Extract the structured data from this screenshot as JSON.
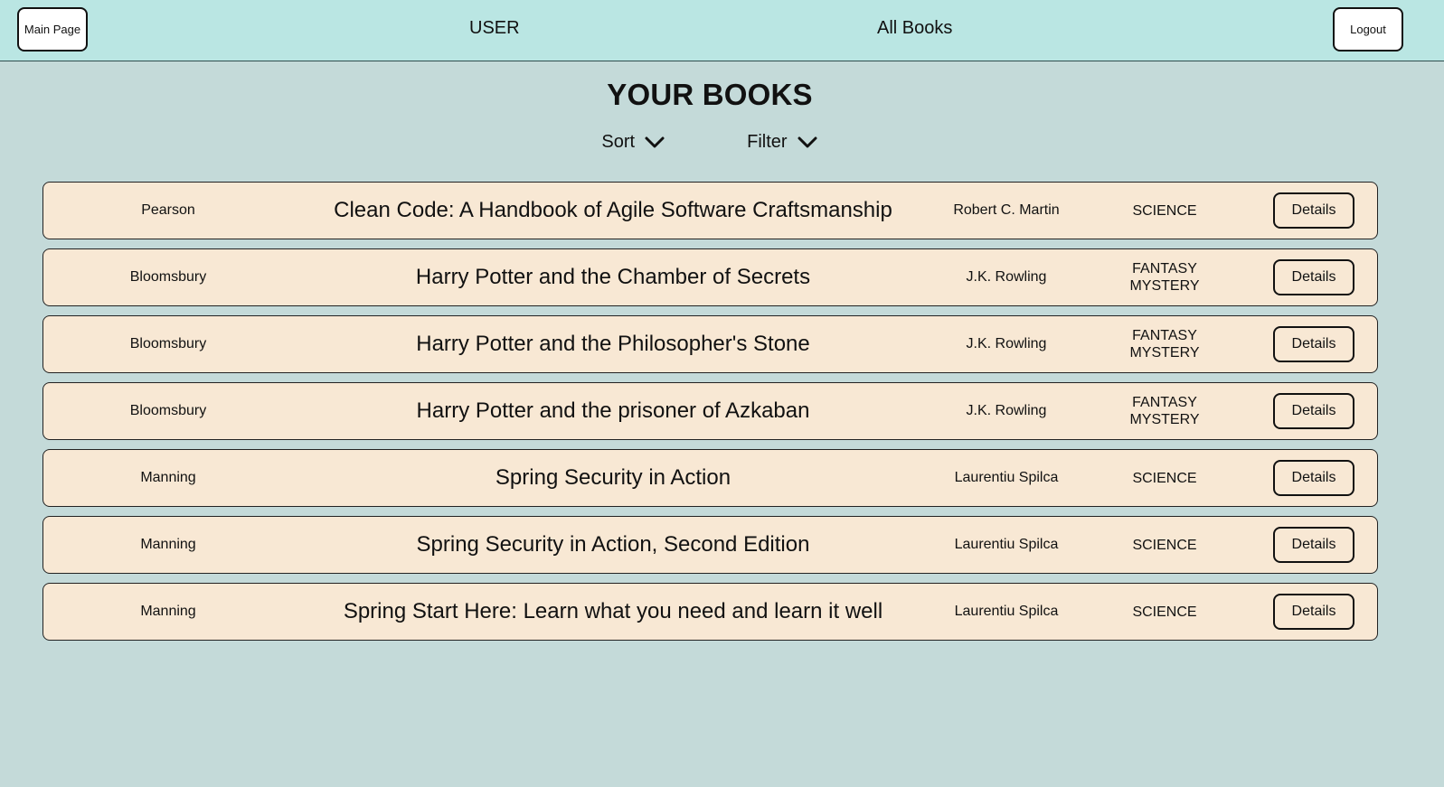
{
  "header": {
    "main_page_label": "Main Page",
    "user_label": "USER",
    "all_books_label": "All Books",
    "logout_label": "Logout"
  },
  "page": {
    "title": "YOUR BOOKS",
    "sort_label": "Sort",
    "filter_label": "Filter"
  },
  "books": [
    {
      "publisher": "Pearson",
      "title": "Clean Code: A Handbook of Agile Software Craftsmanship",
      "author": "Robert C. Martin",
      "genres": [
        "SCIENCE"
      ],
      "details_label": "Details"
    },
    {
      "publisher": "Bloomsbury",
      "title": "Harry Potter and the Chamber of Secrets",
      "author": "J.K. Rowling",
      "genres": [
        "FANTASY",
        "MYSTERY"
      ],
      "details_label": "Details"
    },
    {
      "publisher": "Bloomsbury",
      "title": "Harry Potter and the Philosopher's Stone",
      "author": "J.K. Rowling",
      "genres": [
        "FANTASY",
        "MYSTERY"
      ],
      "details_label": "Details"
    },
    {
      "publisher": "Bloomsbury",
      "title": "Harry Potter and the prisoner of Azkaban",
      "author": "J.K. Rowling",
      "genres": [
        "FANTASY",
        "MYSTERY"
      ],
      "details_label": "Details"
    },
    {
      "publisher": "Manning",
      "title": "Spring Security in Action",
      "author": "Laurentiu Spilca",
      "genres": [
        "SCIENCE"
      ],
      "details_label": "Details"
    },
    {
      "publisher": "Manning",
      "title": "Spring Security in Action, Second Edition",
      "author": "Laurentiu Spilca",
      "genres": [
        "SCIENCE"
      ],
      "details_label": "Details"
    },
    {
      "publisher": "Manning",
      "title": "Spring Start Here: Learn what you need and learn it well",
      "author": "Laurentiu Spilca",
      "genres": [
        "SCIENCE"
      ],
      "details_label": "Details"
    }
  ],
  "colors": {
    "page_background": "#c4dad9",
    "header_background": "#bae6e3",
    "row_background": "#f8e8d4"
  },
  "icons": {
    "sort": "chevron-down-icon",
    "filter": "chevron-down-icon"
  }
}
